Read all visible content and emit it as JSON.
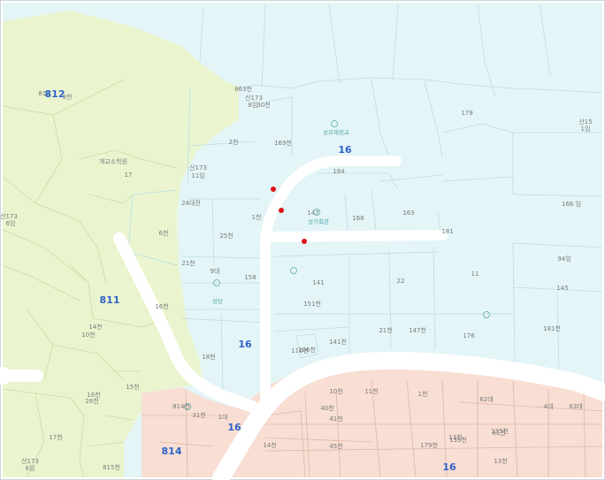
{
  "colors": {
    "green_zone": "#eaf5cf",
    "blue_zone": "#e4f5f7",
    "pink_zone": "#f8ded3",
    "parcel_line_green": "#c9dca5",
    "parcel_line_blue": "#b9dde2",
    "parcel_line_pink": "#e0b7aa",
    "road": "#ffffff",
    "marker": "#e0141b",
    "block_number": "#2f62c9",
    "building_label": "#56a6a6",
    "parcel_label": "#7a7a7a"
  },
  "markers": [
    {
      "name": "marker-1"
    },
    {
      "name": "marker-2"
    },
    {
      "name": "marker-3"
    }
  ],
  "block_numbers": [
    "812",
    "811",
    "16",
    "16",
    "16",
    "814",
    "16"
  ],
  "building_labels": [
    "성모해정교",
    "성가회관",
    "성당"
  ],
  "labels": [
    "812",
    "3천",
    "863천",
    "산173",
    "8임",
    "30천",
    "2천",
    "169천",
    "개교소학원",
    "17",
    "산173",
    "11임",
    "24대전",
    "6천",
    "25천",
    "1천",
    "147",
    "168",
    "163",
    "184",
    "181",
    "179",
    "산15",
    "1임",
    "166 임",
    "산173",
    "6임",
    "21천",
    "9대",
    "158",
    "141",
    "22",
    "11",
    "94임",
    "145",
    "14천",
    "16천",
    "151천",
    "21천",
    "147천",
    "176",
    "181천",
    "110천",
    "15천",
    "16천",
    "26천",
    "141천",
    "106천",
    "18천",
    "10천",
    "11천",
    "40천",
    "1천",
    "41천",
    "4대",
    "63대",
    "814천",
    "31천",
    "62대",
    "61천",
    "1대",
    "14천",
    "45천",
    "179천",
    "13천",
    "135천",
    "135천",
    "13천",
    "산173",
    "8임",
    "815천",
    "17천",
    "10천"
  ]
}
